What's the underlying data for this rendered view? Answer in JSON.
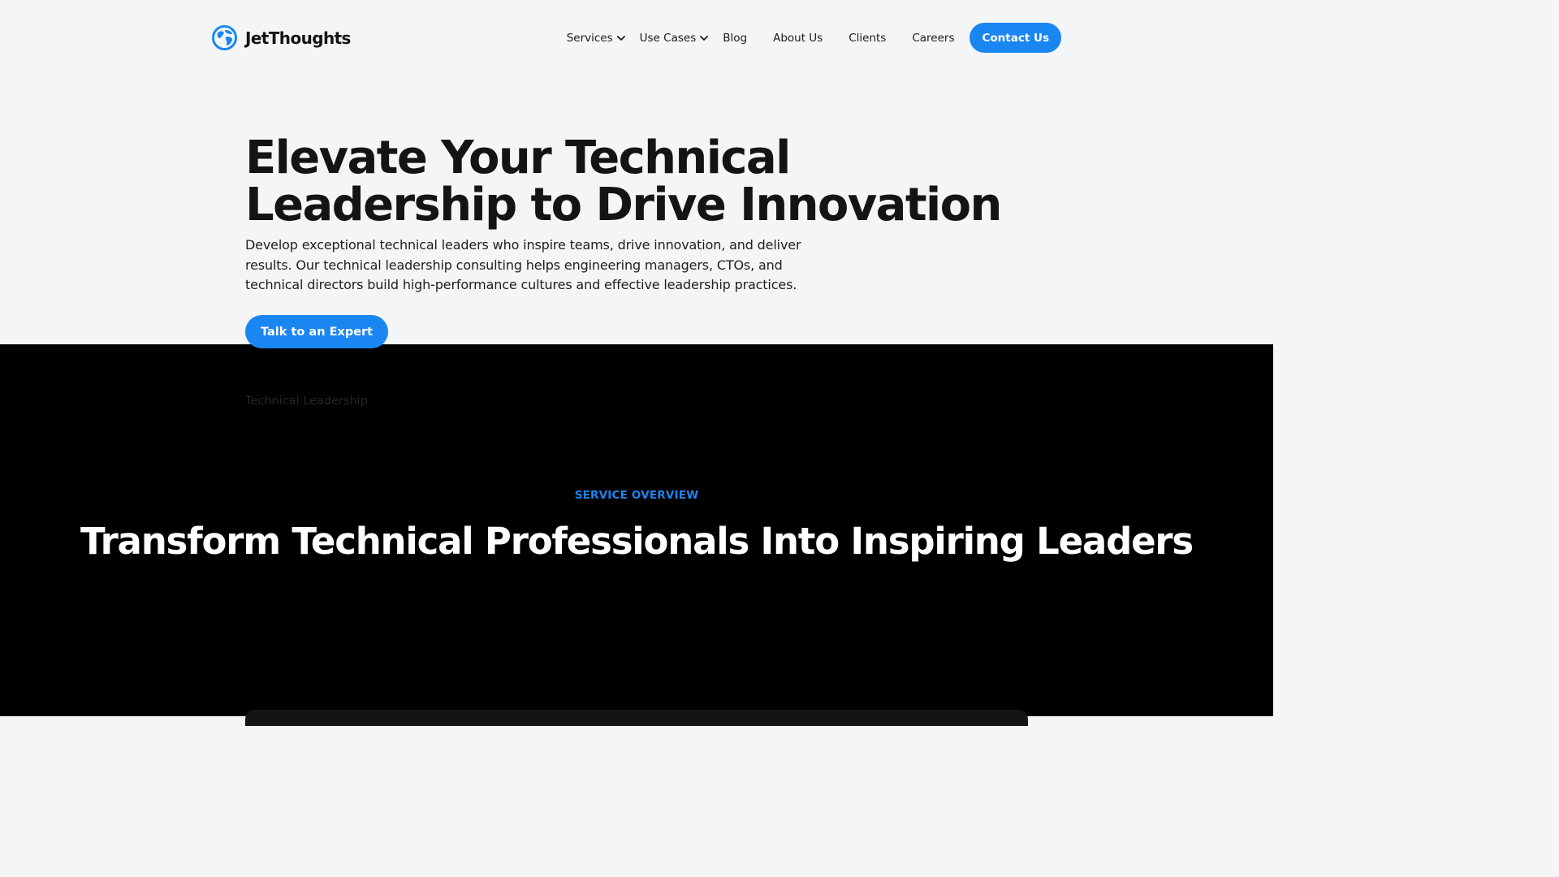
{
  "header": {
    "logo_text": "JetThoughts",
    "nav": [
      {
        "label": "Services",
        "has_dropdown": true
      },
      {
        "label": "Use Cases",
        "has_dropdown": true
      },
      {
        "label": "Blog"
      },
      {
        "label": "About Us"
      },
      {
        "label": "Clients"
      },
      {
        "label": "Careers"
      }
    ],
    "contact_label": "Contact Us"
  },
  "hero": {
    "title": "Elevate Your Technical Leadership to Drive Innovation",
    "description": "Develop exceptional technical leaders who inspire teams, drive innovation, and deliver results. Our technical leadership consulting helps engineering managers, CTOs, and technical directors build high-performance cultures and effective leadership practices.",
    "cta_label": "Talk to an Expert"
  },
  "overview": {
    "breadcrumb": "Technical Leadership",
    "eyebrow": "SERVICE OVERVIEW",
    "title": "Transform Technical Professionals Into Inspiring Leaders"
  },
  "colors": {
    "accent": "#1a86f2",
    "page_bg": "#f4f5f7",
    "dark_bg": "#000000",
    "text": "#141414"
  },
  "icons": {
    "logo": "jetthoughts-globe-icon",
    "dropdown": "chevron-down-icon"
  }
}
